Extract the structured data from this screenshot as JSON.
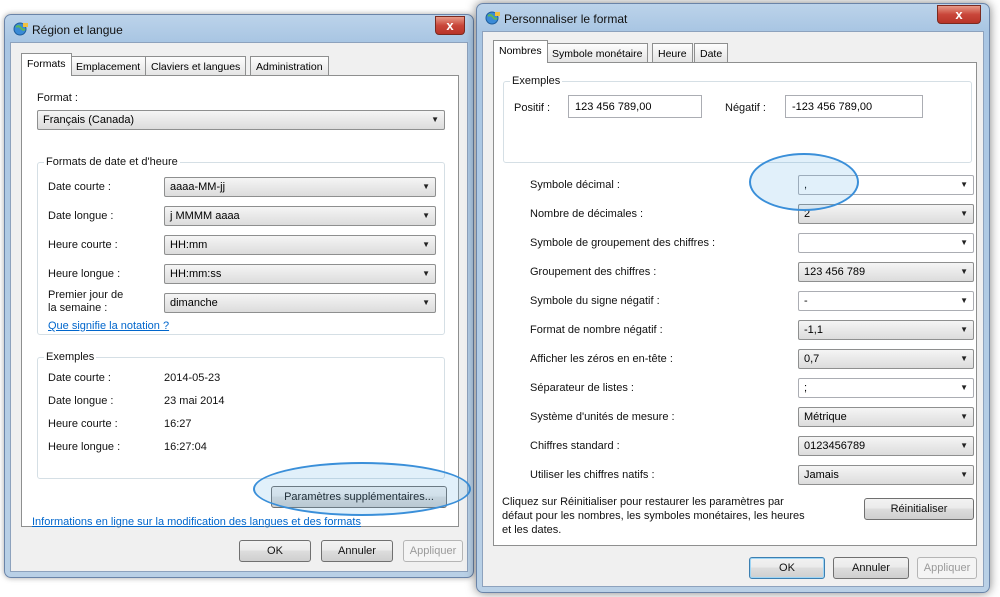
{
  "left_window": {
    "title": "Région et langue",
    "close": "x",
    "tabs": [
      "Formats",
      "Emplacement",
      "Claviers et langues",
      "Administration"
    ],
    "format_label": "Format :",
    "format_value": "Français (Canada)",
    "group_title": "Formats de date et d'heure",
    "rows": [
      {
        "label": "Date courte :",
        "value": "aaaa-MM-jj"
      },
      {
        "label": "Date longue :",
        "value": "j MMMM aaaa"
      },
      {
        "label": "Heure courte :",
        "value": "HH:mm"
      },
      {
        "label": "Heure longue :",
        "value": "HH:mm:ss"
      }
    ],
    "first_day_label_1": "Premier jour de",
    "first_day_label_2": "la semaine :",
    "first_day_value": "dimanche",
    "notation_link": "Que signifie la notation ?",
    "examples_title": "Exemples",
    "examples": [
      {
        "label": "Date courte :",
        "value": "2014-05-23"
      },
      {
        "label": "Date longue :",
        "value": "23 mai 2014"
      },
      {
        "label": "Heure courte :",
        "value": "16:27"
      },
      {
        "label": "Heure longue :",
        "value": "16:27:04"
      }
    ],
    "more_settings_button": "Paramètres supplémentaires...",
    "info_link": "Informations en ligne sur la modification des langues et des formats",
    "ok": "OK",
    "cancel": "Annuler",
    "apply": "Appliquer"
  },
  "right_window": {
    "title": "Personnaliser le format",
    "close": "x",
    "tabs": [
      "Nombres",
      "Symbole monétaire",
      "Heure",
      "Date"
    ],
    "examples_title": "Exemples",
    "positive_label": "Positif :",
    "positive_value": "123 456 789,00",
    "negative_label": "Négatif :",
    "negative_value": "-123 456 789,00",
    "settings": [
      {
        "label": "Symbole décimal :",
        "value": ","
      },
      {
        "label": "Nombre de décimales :",
        "value": "2"
      },
      {
        "label": "Symbole de groupement des chiffres :",
        "value": ""
      },
      {
        "label": "Groupement des chiffres :",
        "value": "123 456 789"
      },
      {
        "label": "Symbole du signe négatif :",
        "value": "-"
      },
      {
        "label": "Format de nombre négatif :",
        "value": "-1,1"
      },
      {
        "label": "Afficher les zéros en en-tête :",
        "value": "0,7"
      },
      {
        "label": "Séparateur de listes :",
        "value": ";"
      },
      {
        "label": "Système d'unités de mesure :",
        "value": "Métrique"
      },
      {
        "label": "Chiffres standard :",
        "value": "0123456789"
      },
      {
        "label": "Utiliser les chiffres natifs :",
        "value": "Jamais"
      }
    ],
    "reset_note_1": "Cliquez sur Réinitialiser pour restaurer les paramètres par",
    "reset_note_2": "défaut pour les nombres, les symboles monétaires, les heures",
    "reset_note_3": "et les dates.",
    "reset_button": "Réinitialiser",
    "ok": "OK",
    "cancel": "Annuler",
    "apply": "Appliquer"
  },
  "colors": {
    "highlight": "#3a8fd9",
    "link": "#0066cc",
    "close": "#c9463a"
  }
}
